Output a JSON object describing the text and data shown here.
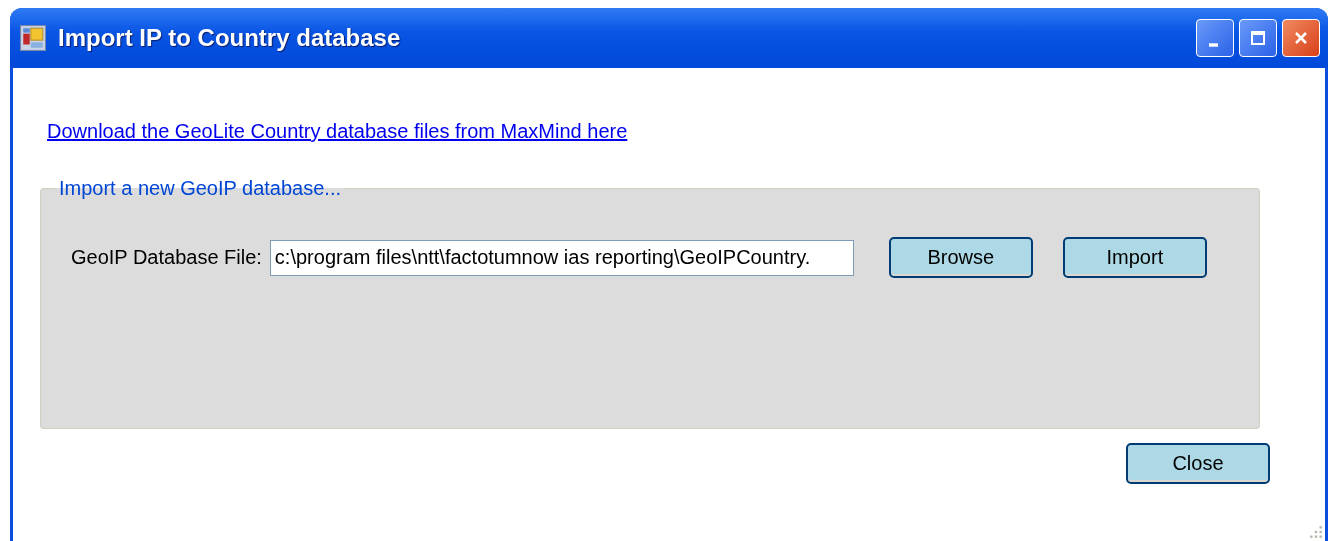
{
  "window": {
    "title": "Import IP to Country database"
  },
  "link": "Download the GeoLite Country database files from MaxMind here",
  "group": {
    "legend": "Import a new GeoIP database...",
    "field": {
      "label": "GeoIP Database File:",
      "value": "c:\\program files\\ntt\\factotumnow ias reporting\\GeoIPCountry."
    },
    "buttons": [
      "Browse",
      "Import"
    ]
  },
  "footer_buttons": [
    "Close"
  ]
}
